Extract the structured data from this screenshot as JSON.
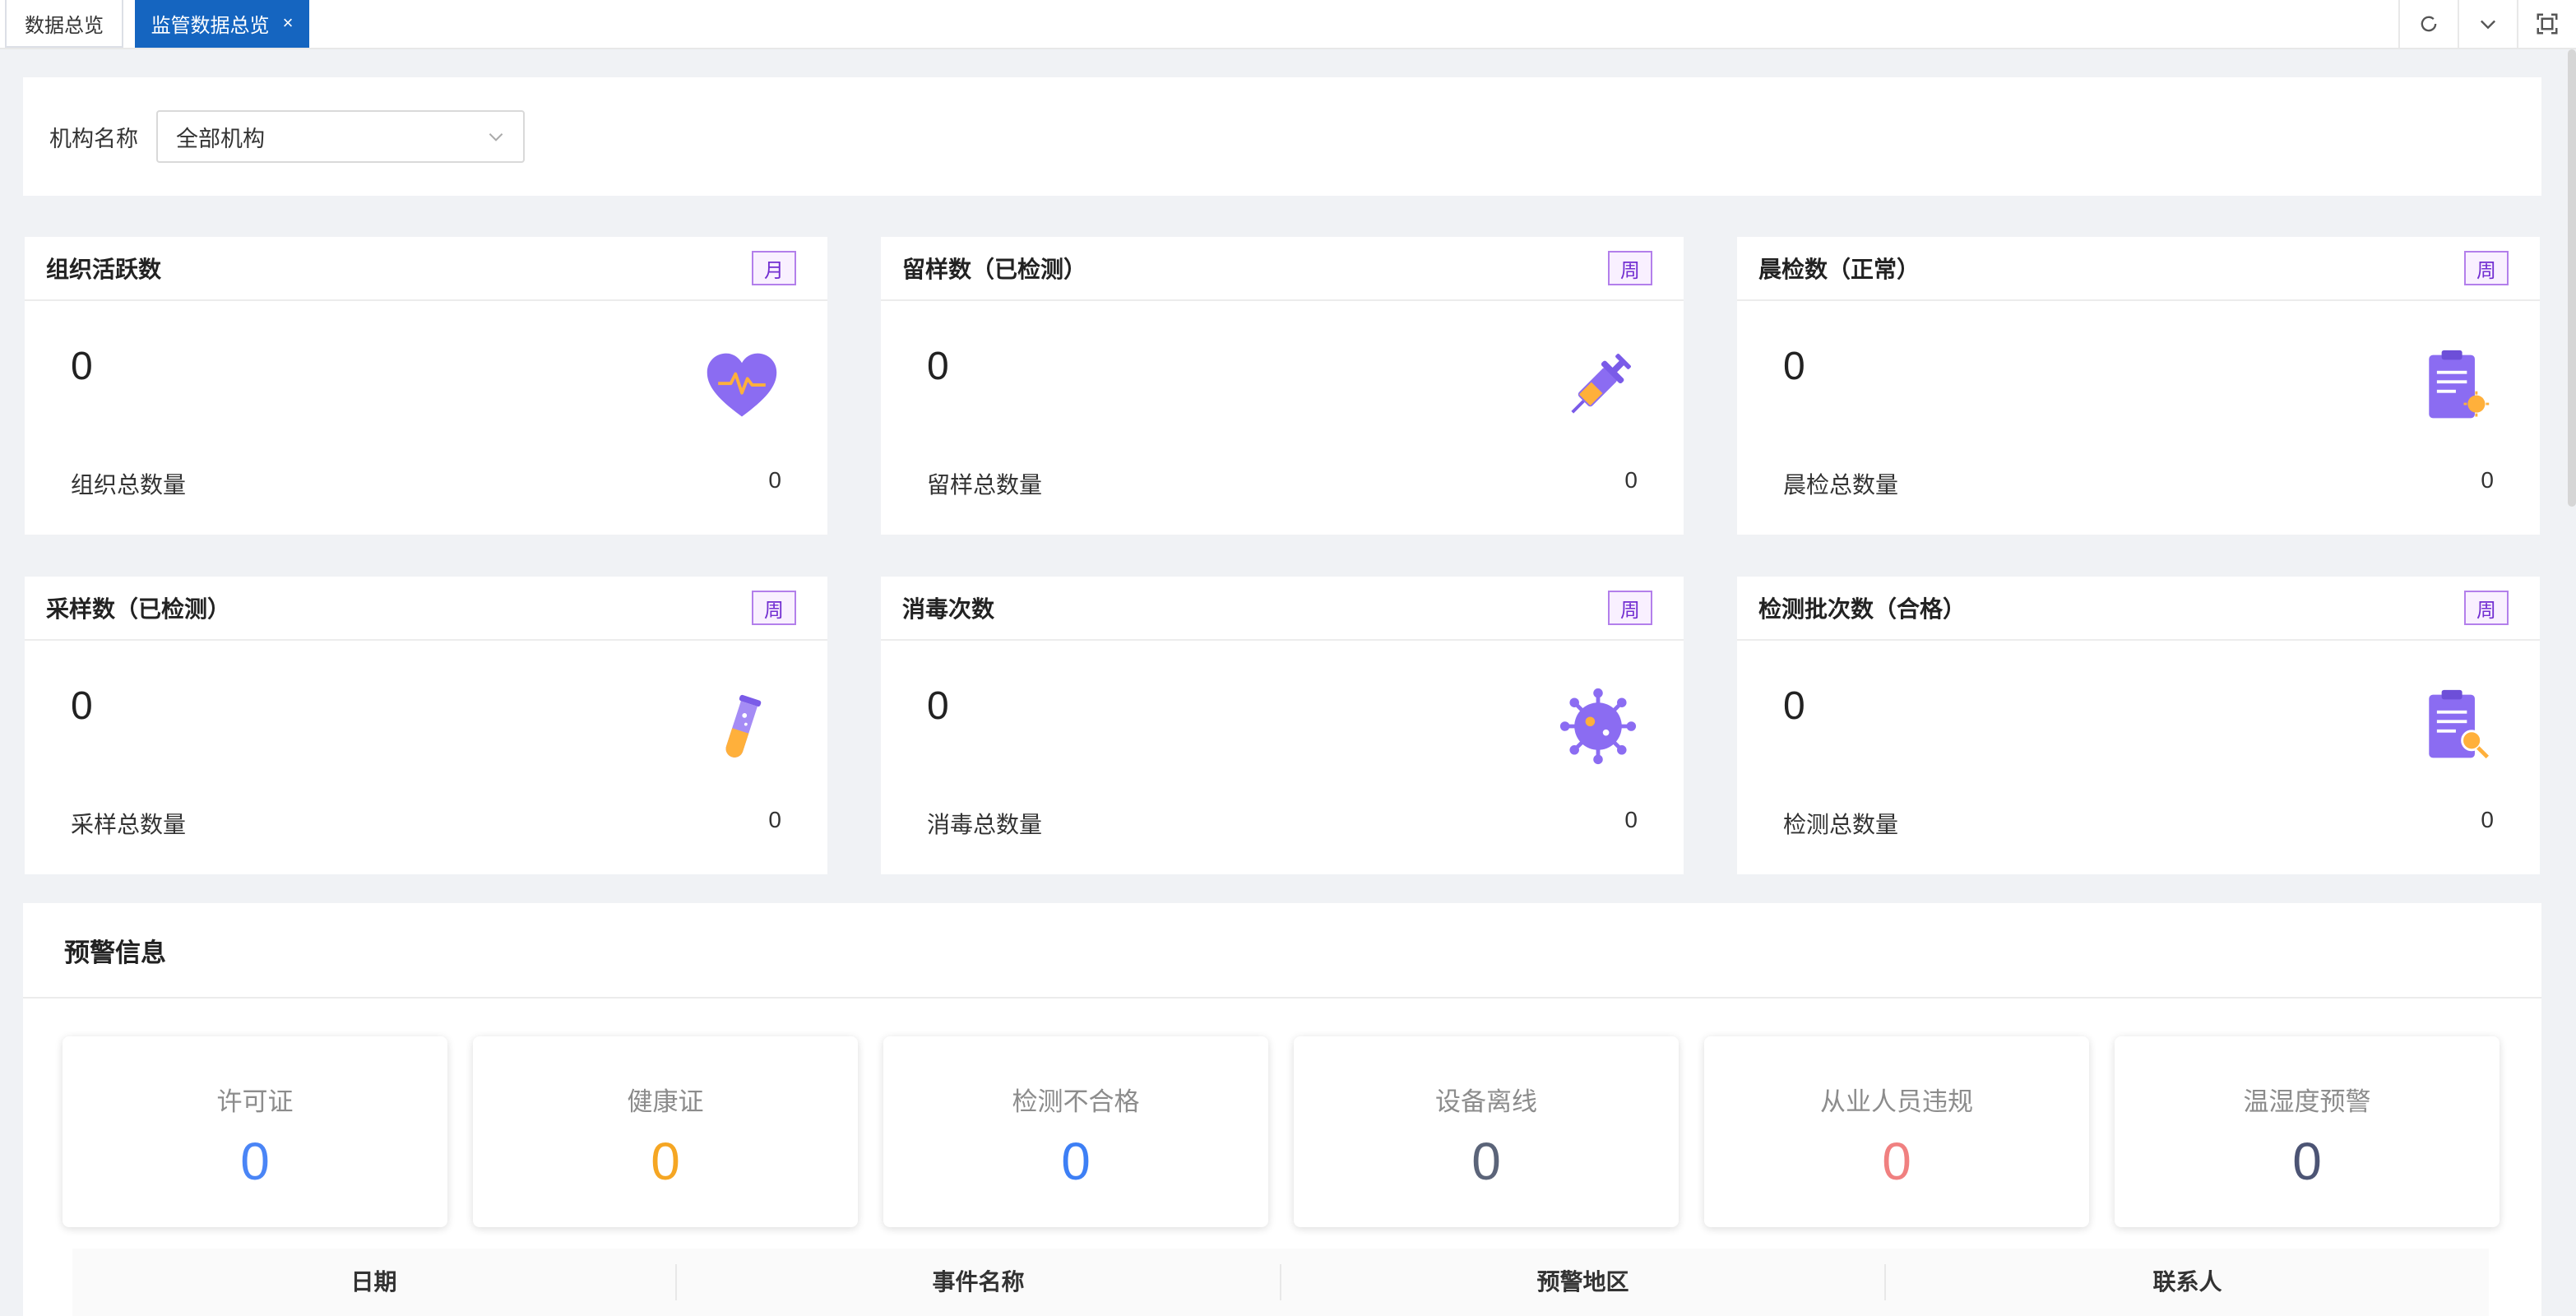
{
  "tabs": [
    {
      "label": "数据总览",
      "active": false
    },
    {
      "label": "监管数据总览",
      "active": true,
      "close": "×"
    }
  ],
  "filter": {
    "label": "机构名称",
    "selected": "全部机构"
  },
  "cards": [
    {
      "title": "组织活跃数",
      "period": "月",
      "value": "0",
      "foot_label": "组织总数量",
      "foot_value": "0",
      "icon": "heart-pulse-icon"
    },
    {
      "title": "留样数（已检测）",
      "period": "周",
      "value": "0",
      "foot_label": "留样总数量",
      "foot_value": "0",
      "icon": "syringe-icon"
    },
    {
      "title": "晨检数（正常）",
      "period": "周",
      "value": "0",
      "foot_label": "晨检总数量",
      "foot_value": "0",
      "icon": "checklist-icon"
    },
    {
      "title": "采样数（已检测）",
      "period": "周",
      "value": "0",
      "foot_label": "采样总数量",
      "foot_value": "0",
      "icon": "test-tube-icon"
    },
    {
      "title": "消毒次数",
      "period": "周",
      "value": "0",
      "foot_label": "消毒总数量",
      "foot_value": "0",
      "icon": "virus-icon"
    },
    {
      "title": "检测批次数（合格）",
      "period": "周",
      "value": "0",
      "foot_label": "检测总数量",
      "foot_value": "0",
      "icon": "report-search-icon"
    }
  ],
  "warning": {
    "title": "预警信息",
    "items": [
      {
        "label": "许可证",
        "value": "0",
        "color": "#4a85f6"
      },
      {
        "label": "健康证",
        "value": "0",
        "color": "#f5a623"
      },
      {
        "label": "检测不合格",
        "value": "0",
        "color": "#3d7ff5"
      },
      {
        "label": "设备离线",
        "value": "0",
        "color": "#5b6479"
      },
      {
        "label": "从业人员违规",
        "value": "0",
        "color": "#f08080"
      },
      {
        "label": "温湿度预警",
        "value": "0",
        "color": "#4c5474"
      }
    ],
    "columns": [
      "日期",
      "事件名称",
      "预警地区",
      "联系人"
    ]
  },
  "colors": {
    "accent": "#1565c0",
    "badge": "#722ed1",
    "icon_primary": "#8b6cf2"
  }
}
